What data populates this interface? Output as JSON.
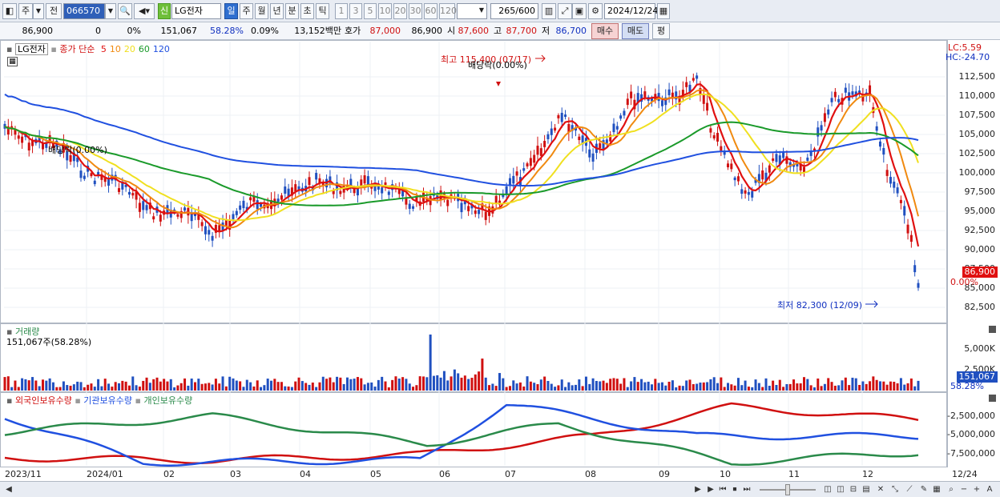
{
  "toolbar": {
    "market_label": "주",
    "prev_label": "전",
    "code": "066570",
    "badge": "신",
    "name": "LG전자",
    "periods": [
      "일",
      "주",
      "월",
      "년",
      "분",
      "초",
      "틱"
    ],
    "active_period": "일",
    "minute_units": [
      "1",
      "3",
      "5",
      "10",
      "20",
      "30",
      "60",
      "120"
    ],
    "count_value": "265",
    "count_total": "/600",
    "date": "2024/12/24"
  },
  "quote": {
    "price": "86,900",
    "change": "0",
    "change_pct": "0%",
    "volume": "151,067",
    "vol_ratio": "58.28%",
    "turnover_pct": "0.09%",
    "amount": "13,152백만",
    "ask_label": "호가",
    "ask_price": "87,000",
    "bid_price": "86,900",
    "open_label": "시",
    "open": "87,600",
    "high_label": "고",
    "high": "87,700",
    "low_label": "저",
    "low": "86,700",
    "buy_btn": "매수",
    "sell_btn": "매도",
    "eval_btn": "평"
  },
  "price_panel": {
    "stock_label": "LG전자",
    "legend_prefix": "종가 단순",
    "ma_periods": [
      "5",
      "10",
      "20",
      "60",
      "120"
    ],
    "ma_colors": [
      "#e01010",
      "#f08a10",
      "#f0e020",
      "#1a9a2a",
      "#2050e0"
    ],
    "lc": "LC:5.59",
    "hc": "HC:-24.70",
    "y_ticks": [
      "112,500",
      "110,000",
      "107,500",
      "105,000",
      "102,500",
      "100,000",
      "97,500",
      "95,000",
      "92,500",
      "90,000",
      "87,500",
      "85,000",
      "82,500"
    ],
    "current_price_tag": "86,900",
    "current_pct_tag": "0.00%",
    "high_annotation": "최고 115,400 (07/17)",
    "low_annotation": "최저 82,300 (12/09)",
    "dividend_1": "배당락(0.00%)",
    "dividend_2": "배당락(0.00%)"
  },
  "volume_panel": {
    "title": "거래량",
    "subtitle": "151,067주(58.28%)",
    "y_ticks": [
      "5,000K",
      "2,500K"
    ],
    "current_tag": "151,067",
    "pct_tag": "58.28%"
  },
  "holdings_panel": {
    "legend": [
      "외국인보유수량",
      "기관보유수량",
      "개인보유수량"
    ],
    "colors": [
      "#d01010",
      "#2050e0",
      "#2a8a4a"
    ],
    "y_ticks": [
      "-2,500,000",
      "-5,000,000",
      "-7,500,000"
    ]
  },
  "x_axis": [
    "2023/11",
    "2024/01",
    "02",
    "03",
    "04",
    "05",
    "06",
    "07",
    "08",
    "09",
    "10",
    "11",
    "12"
  ],
  "x_axis_right": "12/24"
}
